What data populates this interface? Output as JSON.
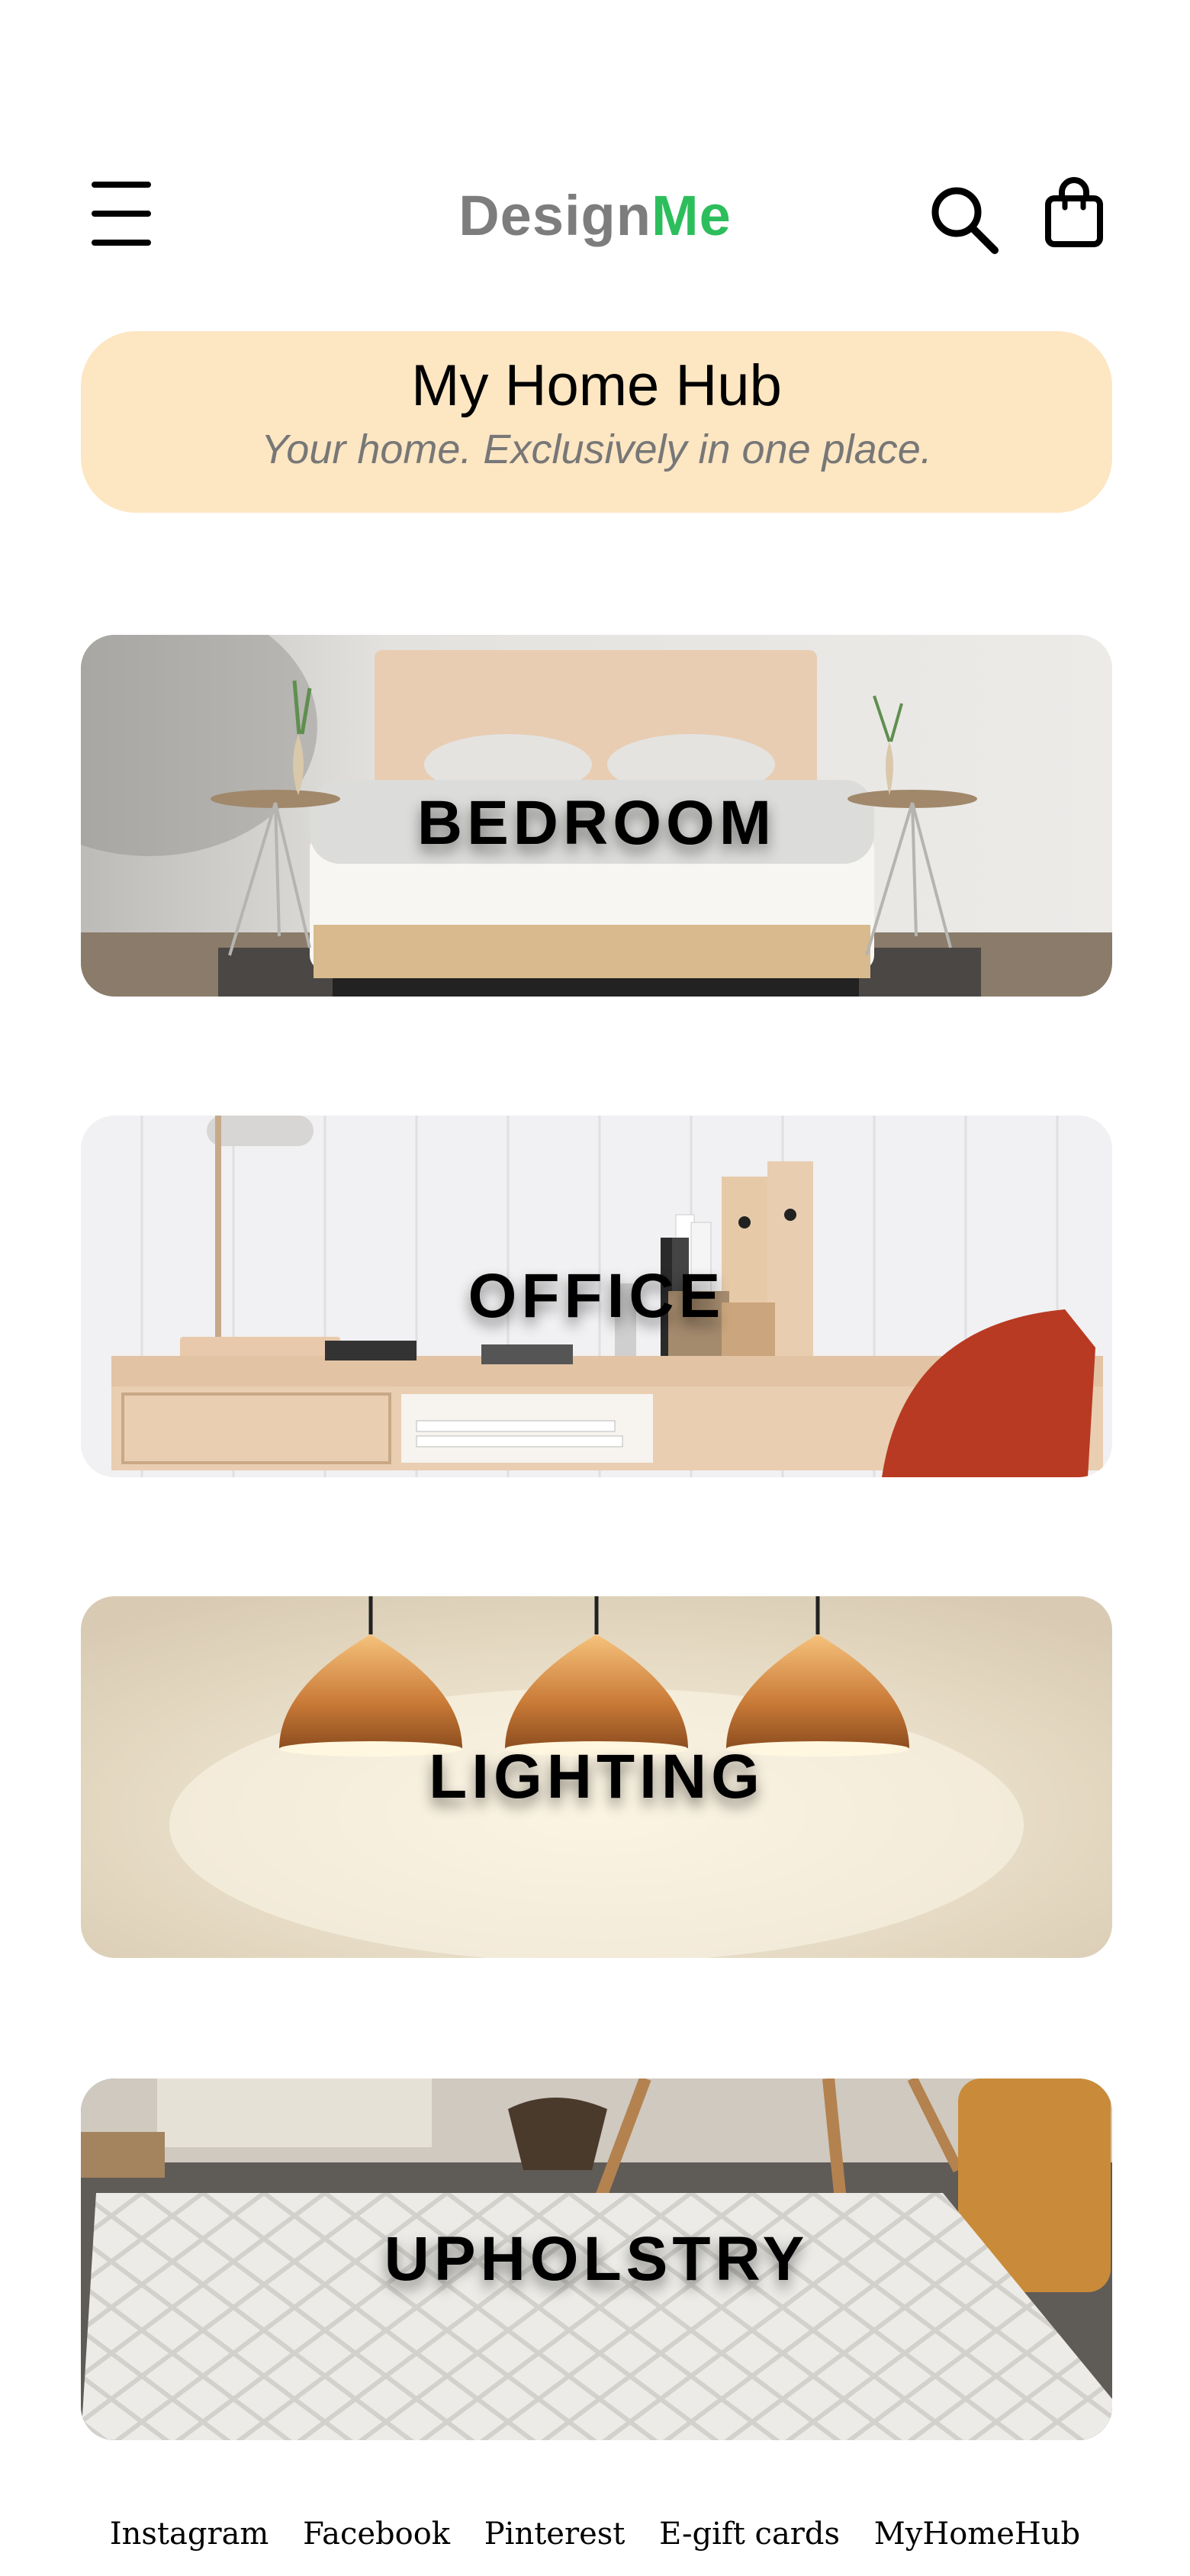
{
  "header": {
    "logo_part1": "Design",
    "logo_part2": "Me",
    "colors": {
      "logo_gray": "#7d7d7d",
      "logo_green": "#2dbe5c"
    },
    "icons": [
      "menu-icon",
      "search-icon",
      "shopping-bag-icon"
    ]
  },
  "hub": {
    "title": "My Home Hub",
    "subtitle": "Your home. Exclusively in one place.",
    "background": "#fde6c2"
  },
  "categories": [
    {
      "label": "BEDROOM"
    },
    {
      "label": "OFFICE"
    },
    {
      "label": "LIGHTING"
    },
    {
      "label": "UPHOLSTRY"
    }
  ],
  "footer": {
    "links": [
      "Instagram",
      "Facebook",
      "Pinterest",
      "E-gift cards",
      "MyHomeHub"
    ]
  }
}
